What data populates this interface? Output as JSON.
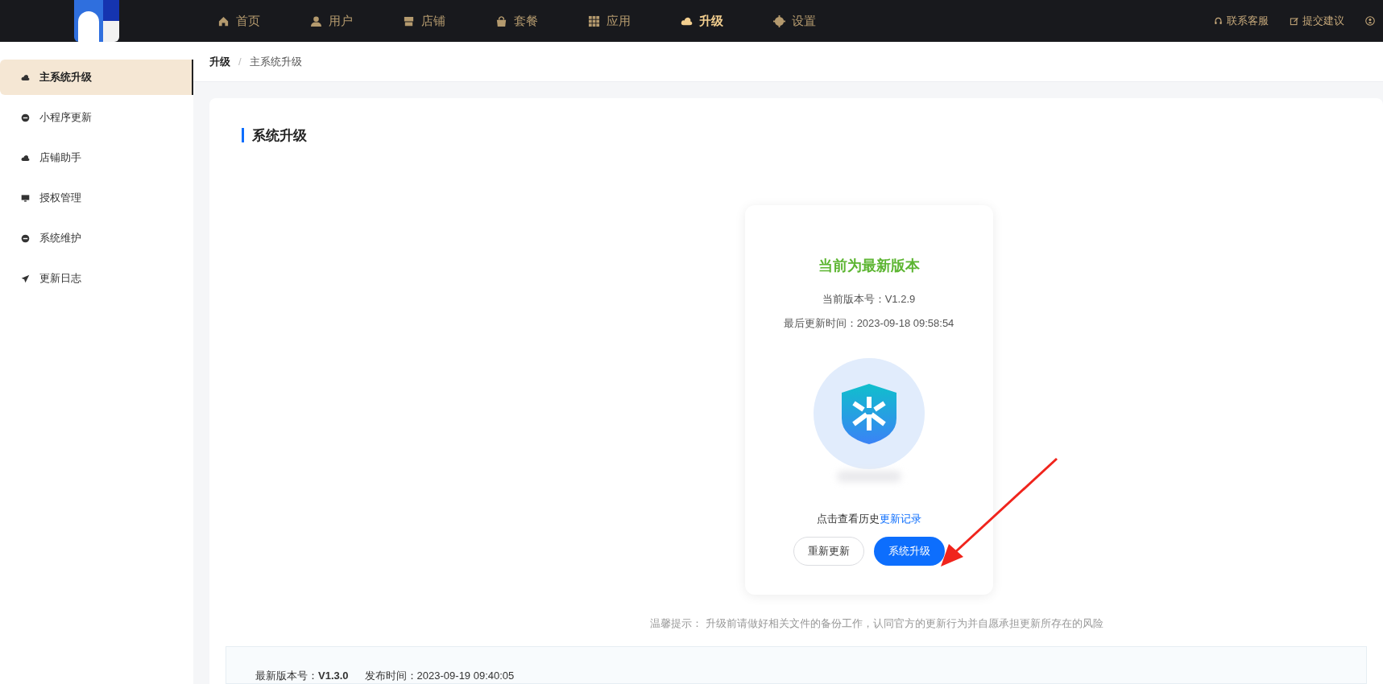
{
  "nav": {
    "items": [
      {
        "label": "首页",
        "kind": "home",
        "selected": false
      },
      {
        "label": "用户",
        "kind": "user",
        "selected": false
      },
      {
        "label": "店铺",
        "kind": "store",
        "selected": false
      },
      {
        "label": "套餐",
        "kind": "bag",
        "selected": false
      },
      {
        "label": "应用",
        "kind": "grid",
        "selected": false
      },
      {
        "label": "升级",
        "kind": "cloud",
        "selected": true
      },
      {
        "label": "设置",
        "kind": "gear",
        "selected": false
      }
    ],
    "links": [
      {
        "label": "联系客服",
        "kind": "headset"
      },
      {
        "label": "提交建议",
        "kind": "edit"
      }
    ]
  },
  "sidebar": {
    "items": [
      {
        "label": "主系统升级",
        "kind": "cloud",
        "selected": true
      },
      {
        "label": "小程序更新",
        "kind": "minus",
        "selected": false
      },
      {
        "label": "店铺助手",
        "kind": "cloud",
        "selected": false
      },
      {
        "label": "授权管理",
        "kind": "monitor",
        "selected": false
      },
      {
        "label": "系统维护",
        "kind": "minus",
        "selected": false
      },
      {
        "label": "更新日志",
        "kind": "plane",
        "selected": false
      }
    ]
  },
  "breadcrumb": {
    "items": [
      "升级",
      "主系统升级"
    ],
    "separator": "/"
  },
  "section_title": "系统升级",
  "status_card": {
    "headline": "当前为最新版本",
    "version": "当前版本号：V1.2.9",
    "updated": "最后更新时间：2023-09-18 09:58:54",
    "history_text": "点击查看历史",
    "history_link": "更新记录",
    "buttons": [
      {
        "label": "重新更新",
        "kind": "outline"
      },
      {
        "label": "系统升级",
        "kind": "primary"
      }
    ]
  },
  "tip": "温馨提示： 升级前请做好相关文件的备份工作，认同官方的更新行为并自愿承担更新所存在的风险",
  "latest": {
    "version_label": "最新版本号：",
    "version": "V1.3.0",
    "date_label": "发布时间：",
    "date": "2023-09-19 09:40:05"
  }
}
